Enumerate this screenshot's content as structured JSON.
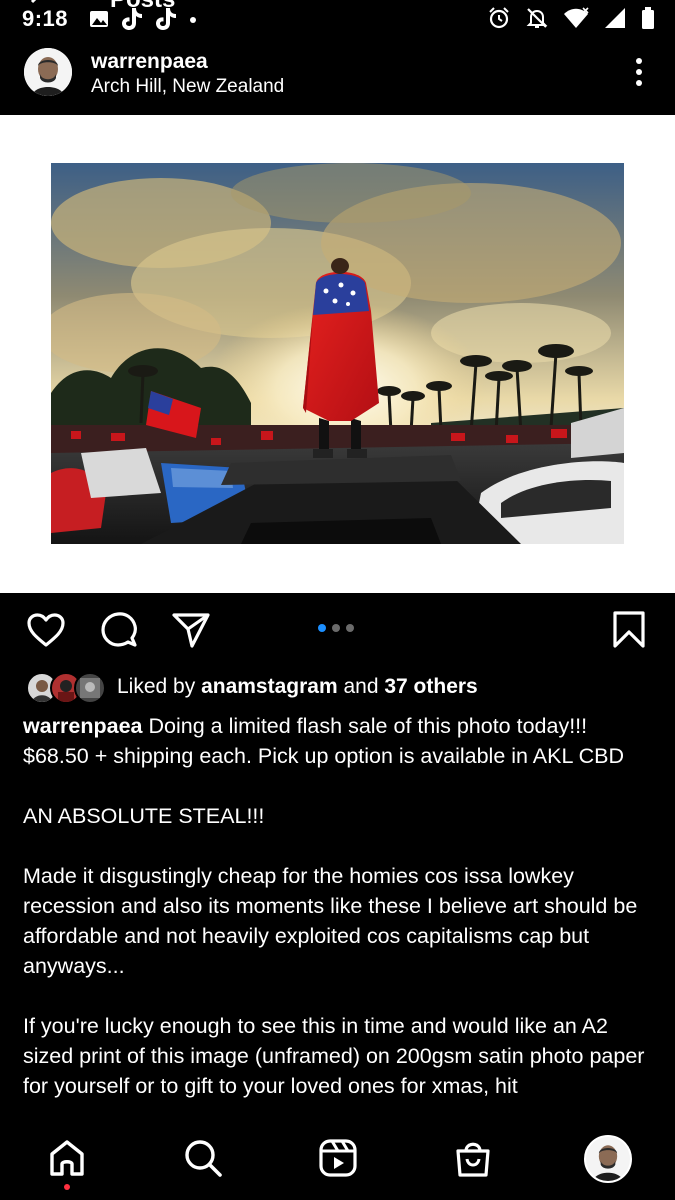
{
  "status_bar": {
    "time": "9:18",
    "left_icons": [
      "gallery-icon",
      "tiktok-icon",
      "tiktok-icon",
      "dot-icon"
    ],
    "right_icons": [
      "alarm-icon",
      "mute-icon",
      "wifi-icon",
      "signal-icon",
      "battery-icon"
    ]
  },
  "screen_title": "Posts",
  "post": {
    "username": "warrenpaea",
    "location": "Arch Hill, New Zealand",
    "carousel": {
      "total": 3,
      "active_index": 0
    },
    "liked_by_prefix": "Liked by",
    "liked_by_user": "anamstagram",
    "liked_by_and": "and",
    "liked_by_others": "37 others",
    "caption": {
      "username": "warrenpaea",
      "line1": "Doing a limited flash sale of this photo today!!! $68.50 + shipping each. Pick up option is available in AKL CBD",
      "line2": "AN ABSOLUTE STEAL!!!",
      "line3": "Made it disgustingly cheap for the homies cos issa lowkey recession and also its moments like these I believe art should be affordable and not heavily exploited cos capitalisms cap but anyways...",
      "line4": "If you're lucky enough to see this in time and would like an A2 sized print of this image (unframed) on 200gsm satin photo paper for yourself or to gift to your loved ones for xmas, hit"
    }
  },
  "actions": [
    "heart-icon",
    "comment-icon",
    "share-icon",
    "bookmark-icon"
  ],
  "bottom_nav": [
    "home-icon",
    "search-icon",
    "reels-icon",
    "shop-icon",
    "profile-avatar"
  ],
  "colors": {
    "background": "#000000",
    "accent": "#1c8fff",
    "notification": "#ff3040",
    "flag_red": "#d8161b",
    "flag_blue": "#2a3f9c"
  }
}
